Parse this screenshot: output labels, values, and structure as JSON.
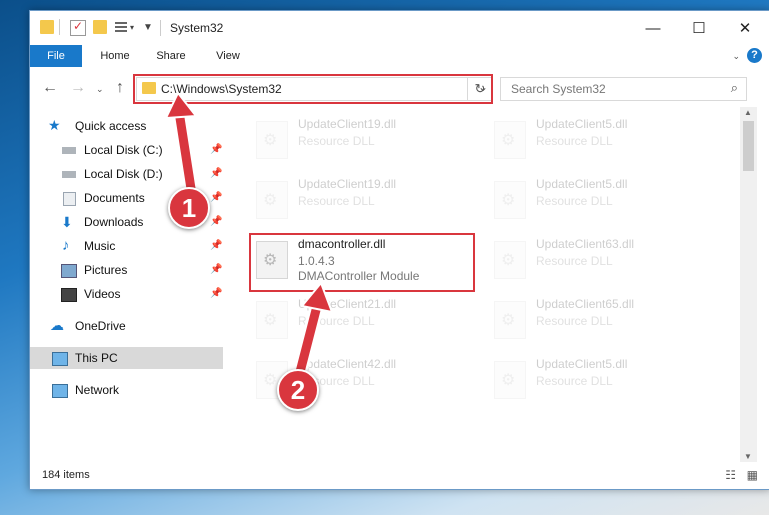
{
  "window": {
    "title": "System32"
  },
  "ribbon": {
    "tabs": [
      "File",
      "Home",
      "Share",
      "View"
    ]
  },
  "help_label": "?",
  "address": {
    "path": "C:\\Windows\\System32"
  },
  "search": {
    "placeholder": "Search System32"
  },
  "nav": {
    "items": [
      {
        "label": "Quick access"
      },
      {
        "label": "Local Disk (C:)"
      },
      {
        "label": "Local Disk (D:)"
      },
      {
        "label": "Documents"
      },
      {
        "label": "Downloads"
      },
      {
        "label": "Music"
      },
      {
        "label": "Pictures"
      },
      {
        "label": "Videos"
      },
      {
        "label": "OneDrive"
      },
      {
        "label": "This PC"
      },
      {
        "label": "Network"
      }
    ]
  },
  "files": [
    {
      "name": "UpdateClient19.dll",
      "type": "Resource DLL"
    },
    {
      "name": "UpdateClient5.dll",
      "type": "Resource DLL"
    },
    {
      "name": "UpdateClient19.dll",
      "type": "Resource DLL"
    },
    {
      "name": "UpdateClient5.dll",
      "type": "Resource DLL"
    },
    {
      "name": "dmacontroller.dll",
      "version": "1.0.4.3",
      "description": "DMAController Module"
    },
    {
      "name": "UpdateClient63.dll",
      "type": "Resource DLL"
    },
    {
      "name": "UpdateClient21.dll",
      "type": "Resource DLL"
    },
    {
      "name": "UpdateClient65.dll",
      "type": "Resource DLL"
    },
    {
      "name": "UpdateClient42.dll",
      "type": "Resource DLL"
    },
    {
      "name": "UpdateClient5.dll",
      "type": "Resource DLL"
    }
  ],
  "status": {
    "item_count": "184 items"
  },
  "annotations": {
    "step1": "1",
    "step2": "2"
  },
  "colors": {
    "accent": "#1979ca",
    "highlight": "#d9363e"
  }
}
